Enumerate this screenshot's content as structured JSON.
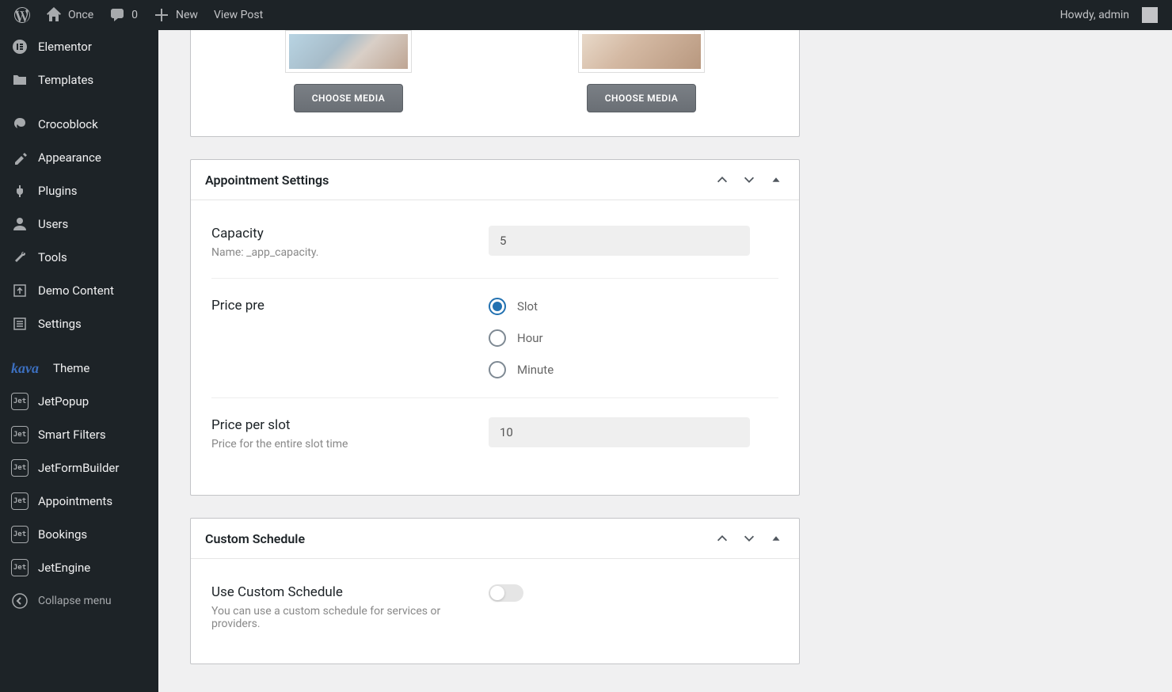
{
  "adminbar": {
    "site_name": "Once",
    "comment_count": "0",
    "new_label": "New",
    "view_post": "View Post",
    "howdy": "Howdy, admin"
  },
  "sidebar": {
    "items": [
      {
        "label": "Elementor",
        "icon": "elementor"
      },
      {
        "label": "Templates",
        "icon": "folder"
      },
      {
        "label": "Crocoblock",
        "icon": "croco"
      },
      {
        "label": "Appearance",
        "icon": "brush"
      },
      {
        "label": "Plugins",
        "icon": "plug"
      },
      {
        "label": "Users",
        "icon": "user"
      },
      {
        "label": "Tools",
        "icon": "wrench"
      },
      {
        "label": "Demo Content",
        "icon": "demo"
      },
      {
        "label": "Settings",
        "icon": "sliders"
      },
      {
        "label": "Theme",
        "icon": "kava"
      },
      {
        "label": "JetPopup",
        "icon": "jet"
      },
      {
        "label": "Smart Filters",
        "icon": "jet"
      },
      {
        "label": "JetFormBuilder",
        "icon": "jet"
      },
      {
        "label": "Appointments",
        "icon": "jet"
      },
      {
        "label": "Bookings",
        "icon": "jet"
      },
      {
        "label": "JetEngine",
        "icon": "jet"
      }
    ],
    "collapse": "Collapse menu"
  },
  "media": {
    "choose_label": "CHOOSE MEDIA"
  },
  "box_appointment": {
    "title": "Appointment Settings",
    "capacity": {
      "title": "Capacity",
      "desc": "Name: _app_capacity.",
      "value": "5"
    },
    "price_pre": {
      "title": "Price pre",
      "options": [
        "Slot",
        "Hour",
        "Minute"
      ],
      "selected": 0
    },
    "price_slot": {
      "title": "Price per slot",
      "desc": "Price for the entire slot time",
      "value": "10"
    }
  },
  "box_schedule": {
    "title": "Custom Schedule",
    "use_custom": {
      "title": "Use Custom Schedule",
      "desc": "You can use a custom schedule for services or providers."
    }
  }
}
